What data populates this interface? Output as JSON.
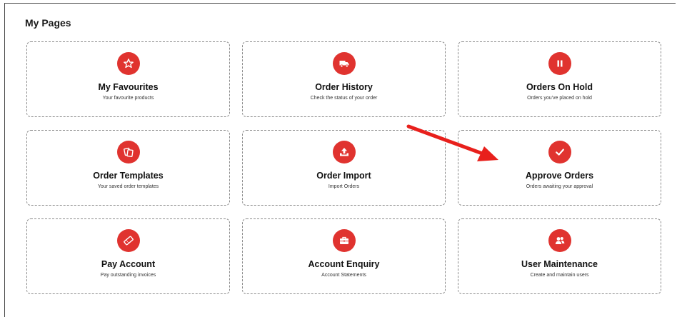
{
  "page": {
    "title": "My Pages"
  },
  "tiles": [
    {
      "title": "My Favourites",
      "subtitle": "Your favourite products",
      "icon": "star-icon"
    },
    {
      "title": "Order History",
      "subtitle": "Check the status of your order",
      "icon": "truck-icon"
    },
    {
      "title": "Orders On Hold",
      "subtitle": "Orders you've placed on hold",
      "icon": "pause-icon"
    },
    {
      "title": "Order Templates",
      "subtitle": "Your saved order templates",
      "icon": "copy-icon"
    },
    {
      "title": "Order Import",
      "subtitle": "Import Orders",
      "icon": "upload-icon"
    },
    {
      "title": "Approve Orders",
      "subtitle": "Orders awaiting your approval",
      "icon": "check-icon"
    },
    {
      "title": "Pay Account",
      "subtitle": "Pay outstanding invoices",
      "icon": "ticket-icon"
    },
    {
      "title": "Account Enquiry",
      "subtitle": "Account Statements",
      "icon": "briefcase-icon"
    },
    {
      "title": "User Maintenance",
      "subtitle": "Create and maintain users",
      "icon": "users-icon"
    }
  ],
  "colors": {
    "accent": "#e0332f",
    "annotation_arrow": "#e8201c"
  }
}
